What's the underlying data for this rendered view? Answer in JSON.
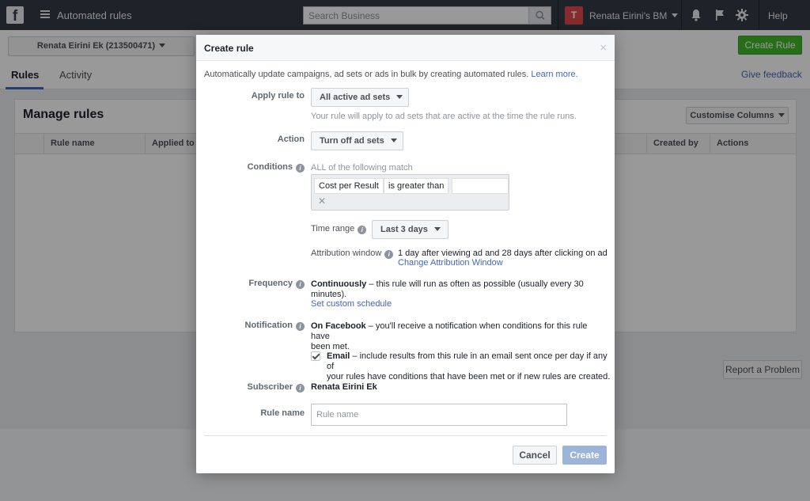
{
  "topbar": {
    "logo": "f",
    "app_title": "Automated rules",
    "search_placeholder": "Search Business",
    "business_initial": "T",
    "business_name": "Renata Eirini's BM",
    "help": "Help"
  },
  "subheader": {
    "account": "Renata Eirini Ek (213500471)",
    "create_rule": "Create Rule",
    "tabs": [
      "Rules",
      "Activity"
    ],
    "give_feedback": "Give feedback"
  },
  "panel": {
    "title": "Manage rules",
    "customise_columns": "Customise Columns",
    "columns": [
      "Rule name",
      "Applied to",
      "Created by",
      "Actions"
    ]
  },
  "report_problem": "Report a Problem",
  "modal": {
    "title": "Create rule",
    "close": "×",
    "description": "Automatically update campaigns, ad sets or ads in bulk by creating automated rules.",
    "learn_more": "Learn more.",
    "apply_rule_to": {
      "label": "Apply rule to",
      "value": "All active ad sets",
      "hint": "Your rule will apply to ad sets that are active at the time the rule runs."
    },
    "action": {
      "label": "Action",
      "value": "Turn off ad sets"
    },
    "conditions": {
      "label": "Conditions",
      "match": "ALL of the following match",
      "metric": "Cost per Result",
      "operator": "is greater than",
      "value": "",
      "remove": "✕"
    },
    "time_range": {
      "label": "Time range",
      "value": "Last 3 days"
    },
    "attribution": {
      "label": "Attribution window",
      "value": "1 day after viewing ad and 28 days after clicking on ad",
      "link": "Change Attribution Window"
    },
    "frequency": {
      "label": "Frequency",
      "bold": "Continuously",
      "text_line1": " – this rule will run as often as possible (usually every 30",
      "text_line2": "minutes).",
      "link": "Set custom schedule"
    },
    "notification": {
      "label": "Notification",
      "bold": "On Facebook",
      "text_line1": " – you'll receive a notification when conditions for this rule have",
      "text_line2": "been met.",
      "email_bold": "Email",
      "email_line1": " – include results from this rule in an email sent once per day if any of",
      "email_line2": "your rules have conditions that have been met or if new rules are created.",
      "email_checked": true
    },
    "subscriber": {
      "label": "Subscriber",
      "value": "Renata Eirini Ek"
    },
    "rule_name": {
      "label": "Rule name",
      "placeholder": "Rule name",
      "value": ""
    },
    "cancel": "Cancel",
    "create": "Create"
  }
}
